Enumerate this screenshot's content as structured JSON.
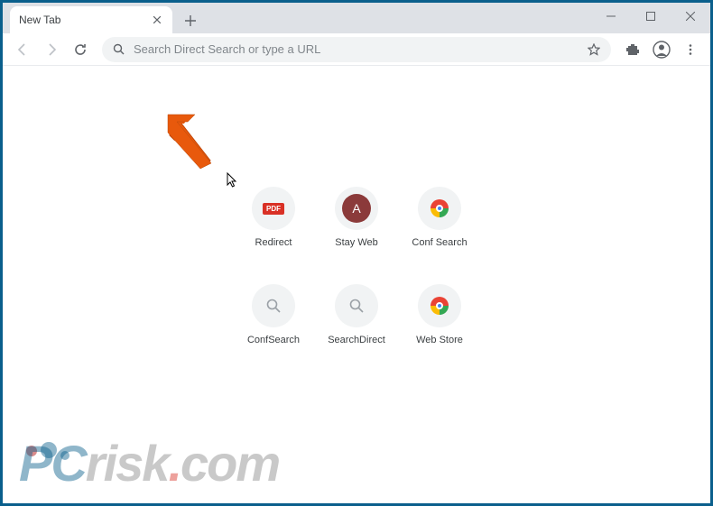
{
  "tab": {
    "title": "New Tab"
  },
  "omnibox": {
    "placeholder": "Search Direct Search or type a URL"
  },
  "shortcuts": [
    {
      "label": "Redirect",
      "name": "shortcut-redirect",
      "icon": "pdf"
    },
    {
      "label": "Stay Web",
      "name": "shortcut-stay-web",
      "icon": "avatar-a",
      "letter": "A"
    },
    {
      "label": "Conf Search",
      "name": "shortcut-conf-search",
      "icon": "chrome"
    },
    {
      "label": "ConfSearch",
      "name": "shortcut-confsearch",
      "icon": "search"
    },
    {
      "label": "SearchDirect",
      "name": "shortcut-searchdirect",
      "icon": "search"
    },
    {
      "label": "Web Store",
      "name": "shortcut-web-store",
      "icon": "chrome"
    }
  ],
  "watermark": {
    "pc": "PC",
    "risk": "risk",
    "com": "com",
    "dot": "."
  },
  "colors": {
    "accent": "#0a5f8c",
    "arrow": "#e8590c"
  }
}
